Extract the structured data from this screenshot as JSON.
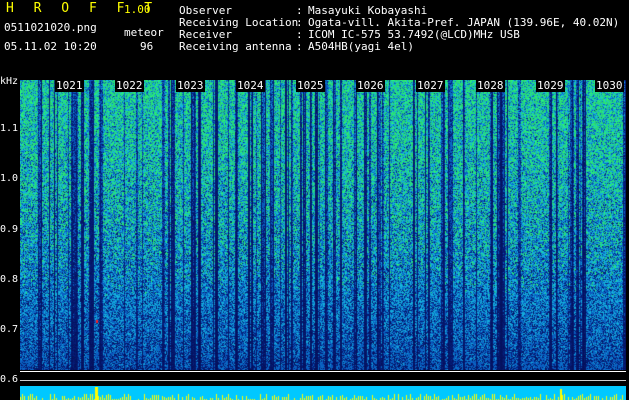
{
  "header": {
    "app_title": "H R O F F T",
    "app_version": "1.00",
    "filename": "0511021020.png",
    "timestamp": "05.11.02 10:20",
    "meteor_label": "meteor",
    "meteor_count": "96"
  },
  "info": [
    {
      "label": "Observer",
      "value": "Masayuki Kobayashi"
    },
    {
      "label": "Receiving Location",
      "value": "Ogata-vill. Akita-Pref. JAPAN (139.96E, 40.02N)"
    },
    {
      "label": "Receiver",
      "value": "ICOM IC-575 53.7492(@LCD)MHz USB"
    },
    {
      "label": "Receiving antenna",
      "value": "A504HB(yagi 4el)"
    }
  ],
  "spectrogram": {
    "y_axis_unit": "kHz",
    "y_ticks": [
      "1.1",
      "1.0",
      "0.9",
      "0.8",
      "0.7",
      "0.6"
    ],
    "x_ticks": [
      "1021",
      "1022",
      "1023",
      "1024",
      "1025",
      "1026",
      "1027",
      "1028",
      "1029",
      "1030"
    ],
    "colors": {
      "background": "#000000",
      "noise_low": "#0a2a90",
      "noise_mid": "#1e6ad8",
      "noise_high": "#20d0a0",
      "peak": "#ffff00",
      "accent": "#ff2020"
    }
  }
}
